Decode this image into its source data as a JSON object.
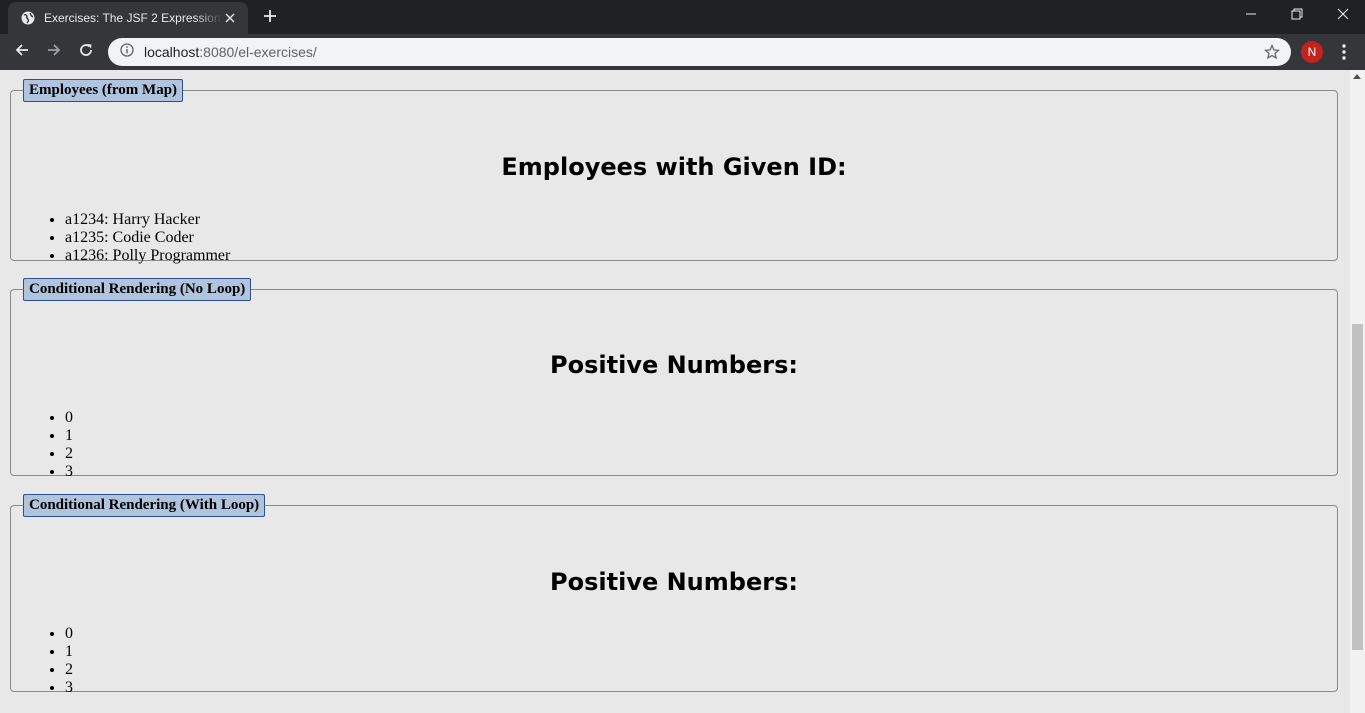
{
  "browser": {
    "tab_title": "Exercises: The JSF 2 Expression Language",
    "url_host": "localhost",
    "url_rest": ":8080/el-exercises/",
    "profile_initial": "N"
  },
  "icons": {
    "favicon": "globe-icon",
    "tab_close": "close-icon",
    "new_tab": "plus-icon",
    "minimize": "minimize-icon",
    "restore": "restore-icon",
    "close_window": "close-window-icon",
    "back": "back-arrow-icon",
    "forward": "forward-arrow-icon",
    "reload": "reload-icon",
    "info": "info-icon",
    "bookmark": "star-icon",
    "menu": "kebab-menu-icon"
  },
  "colors": {
    "legend_bg": "#b0c4de",
    "legend_border": "#2b4f8f",
    "page_bg": "#e8e8e8",
    "avatar_bg": "#c5221f"
  },
  "panels": [
    {
      "legend": "Employees (from Map)",
      "heading": "Employees with Given ID:",
      "items": [
        "a1234: Harry Hacker",
        "a1235: Codie Coder",
        "a1236: Polly Programmer"
      ]
    },
    {
      "legend": "Conditional Rendering (No Loop)",
      "heading": "Positive Numbers:",
      "items": [
        "0",
        "1",
        "2",
        "3"
      ]
    },
    {
      "legend": "Conditional Rendering (With Loop)",
      "heading": "Positive Numbers:",
      "items": [
        "0",
        "1",
        "2",
        "3"
      ]
    }
  ]
}
